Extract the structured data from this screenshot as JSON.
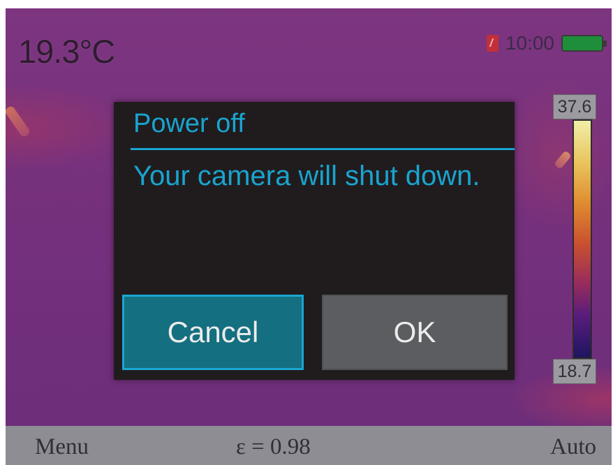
{
  "status_bar": {
    "temperature": "19.3°C",
    "clock": "10:00",
    "sd_icon": "sd-card-icon",
    "battery_icon": "battery-full-icon"
  },
  "scale": {
    "max": "37.6",
    "min": "18.7"
  },
  "dialog": {
    "title": "Power off",
    "message": "Your camera will shut down.",
    "cancel_label": "Cancel",
    "ok_label": "OK"
  },
  "bottom_bar": {
    "menu_label": "Menu",
    "emissivity": "ε = 0.98",
    "mode_label": "Auto"
  },
  "colors": {
    "accent": "#19a4cf",
    "dialog_bg": "#201c1e",
    "cancel_bg": "#146f80",
    "ok_bg": "#5b5d60",
    "bottom_bar_bg": "#8d8d93"
  }
}
